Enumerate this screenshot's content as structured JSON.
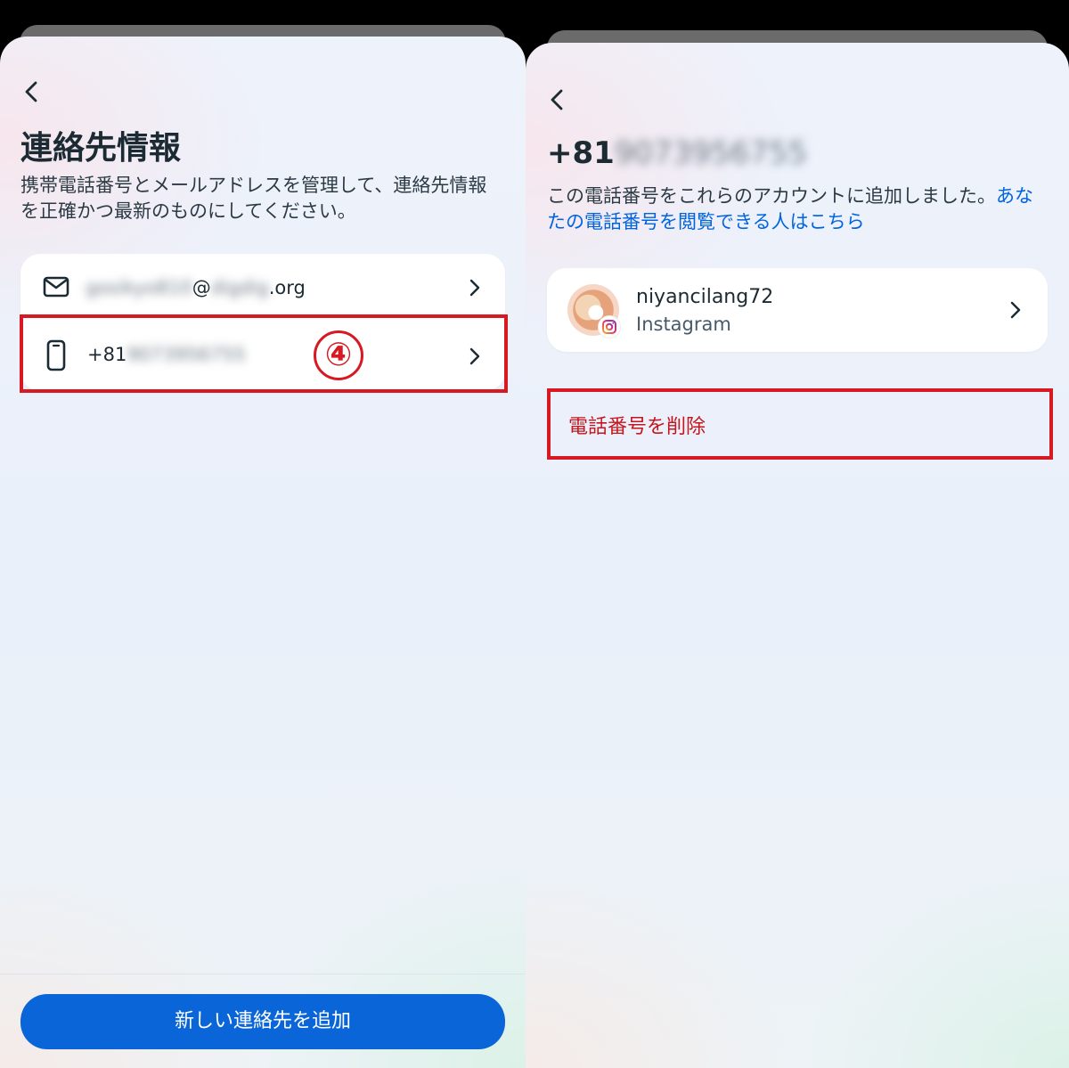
{
  "left": {
    "title": "連絡先情報",
    "description": "携帯電話番号とメールアドレスを管理して、連絡先情報を正確かつ最新のものにしてください。",
    "contacts": [
      {
        "icon": "mail-icon",
        "text_hidden": "gosikyo810",
        "text_visible": "@",
        "text_hidden2": "digdig",
        "text_visible2": ".org"
      },
      {
        "icon": "phone-icon",
        "text_visible": "+81",
        "text_hidden": "9073956755"
      }
    ],
    "annotation_step": "④",
    "add_button_label": "新しい連絡先を追加"
  },
  "right": {
    "phone_visible": "+81",
    "phone_hidden": "9073956755",
    "description_main": "この電話番号をこれらのアカウントに追加しました。",
    "description_link": "あなたの電話番号を閲覧できる人はこちら",
    "account": {
      "username": "niyancilang72",
      "platform": "Instagram"
    },
    "delete_label": "電話番号を削除"
  },
  "colors": {
    "primary": "#0a66d8",
    "link": "#0064e0",
    "danger": "#c4161c",
    "highlight": "#d71921"
  }
}
